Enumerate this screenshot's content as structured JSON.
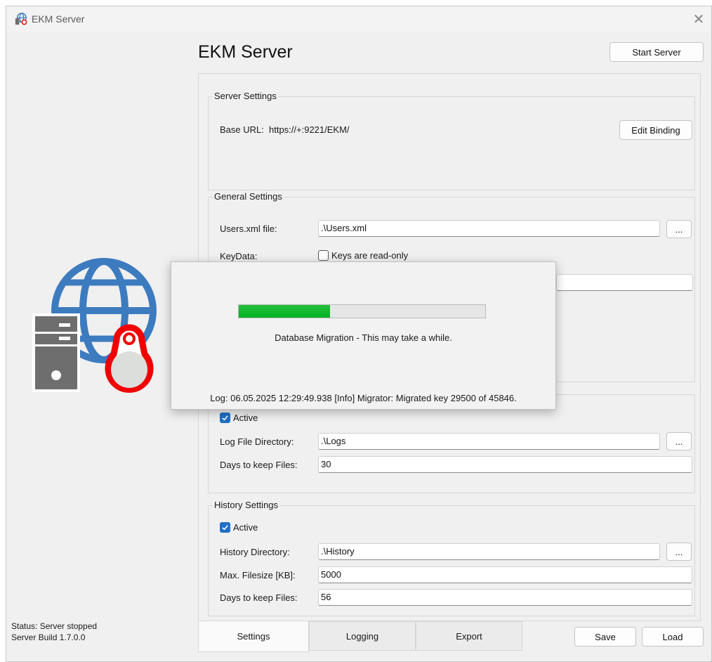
{
  "window": {
    "title": "EKM Server",
    "close_glyph": "✕"
  },
  "header": {
    "app_title": "EKM Server",
    "start_button": "Start Server"
  },
  "server_settings": {
    "title": "Server Settings",
    "base_url_label": "Base URL:",
    "base_url_value": "https://+:9221/EKM/",
    "edit_binding_button": "Edit Binding"
  },
  "general_settings": {
    "title": "General Settings",
    "users_xml_label": "Users.xml file:",
    "users_xml_value": ".\\Users.xml",
    "browse_label": "...",
    "keydata_label": "KeyData:",
    "keys_readonly_label": "Keys are read-only",
    "keys_readonly_checked": false
  },
  "logging_settings": {
    "active_label": "Active",
    "active_checked": true,
    "log_dir_label": "Log File Directory:",
    "log_dir_value": ".\\Logs",
    "browse_label": "...",
    "days_label": "Days to keep Files:",
    "days_value": "30"
  },
  "history_settings": {
    "title": "History Settings",
    "active_label": "Active",
    "active_checked": true,
    "dir_label": "History Directory:",
    "dir_value": ".\\History",
    "browse_label": "...",
    "max_filesize_label": "Max. Filesize [KB]:",
    "max_filesize_value": "5000",
    "days_label": "Days to keep Files:",
    "days_value": "56"
  },
  "status": {
    "line1": "Status: Server stopped",
    "line2": "Server  Build 1.7.0.0"
  },
  "tabs": [
    {
      "label": "Settings",
      "active": true
    },
    {
      "label": "Logging",
      "active": false
    },
    {
      "label": "Export",
      "active": false
    }
  ],
  "footer": {
    "save_button": "Save",
    "load_button": "Load"
  },
  "migration_dialog": {
    "progress": 0.37,
    "message": "Database Migration - This may take a while.",
    "log": "Log: 06.05.2025 12:29:49.938 [Info] Migrator: Migrated key 29500 of 45846."
  },
  "colors": {
    "globe_blue": "#3d7bbf",
    "server_gray": "#6e6e6e",
    "tag_red": "#f00000",
    "progress_green": "#06b025",
    "checkbox_blue": "#1f6fc5"
  },
  "icons": [
    "app-icon",
    "close-icon",
    "globe-server-key-logo",
    "checkmark-icon"
  ]
}
